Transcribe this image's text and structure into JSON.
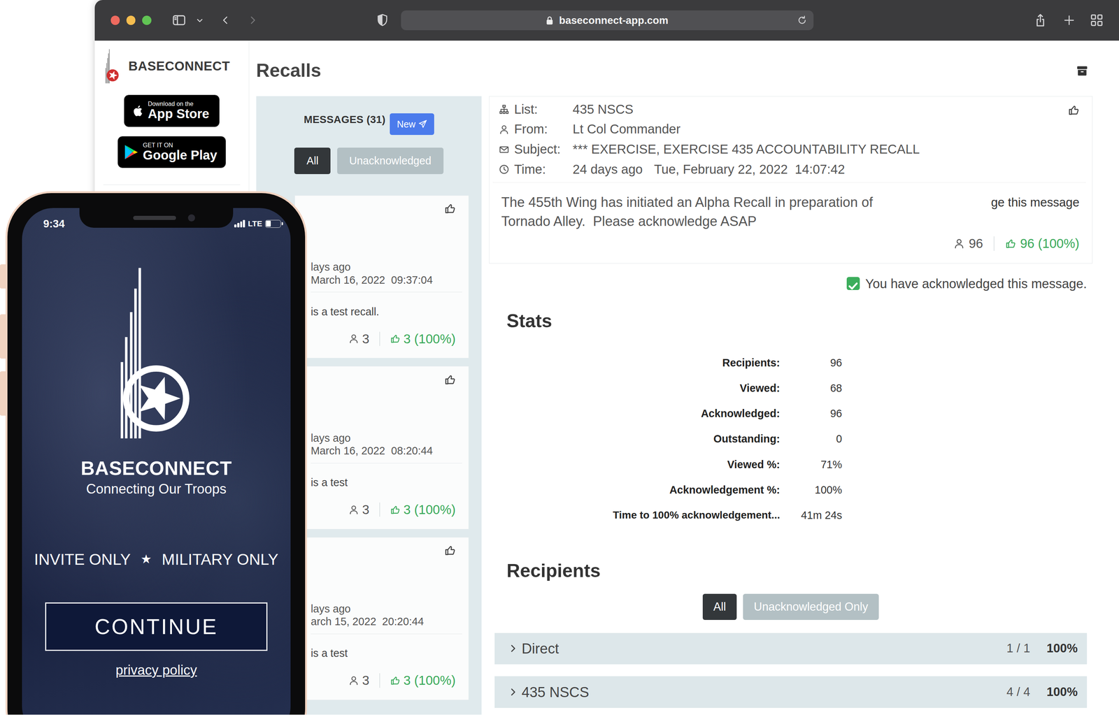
{
  "browser": {
    "traffic_lights": [
      {
        "color": "#ee6a5f"
      },
      {
        "color": "#f5bd4f"
      },
      {
        "color": "#61c454"
      }
    ],
    "url": "baseconnect-app.com"
  },
  "sidebar": {
    "brand": "BASECONNECT",
    "badges": [
      {
        "caption": "Download on the",
        "store": "App Store"
      },
      {
        "caption": "GET IT ON",
        "store": "Google Play"
      }
    ]
  },
  "page": {
    "title": "Recalls"
  },
  "messages": {
    "header": "MESSAGES (31)",
    "new_button": "New",
    "filters": [
      {
        "label": "All",
        "selected": true
      },
      {
        "label": "Unacknowledged",
        "selected": false
      }
    ],
    "items": [
      {
        "ago": "lays ago",
        "time": "March 16, 2022  09:37:04",
        "body": "is a test recall.",
        "recipients": "3",
        "acknowledged": "3 (100%)"
      },
      {
        "ago": "lays ago",
        "time": "March 16, 2022  08:20:44",
        "body": "is a test",
        "recipients": "3",
        "acknowledged": "3 (100%)"
      },
      {
        "ago": "lays ago",
        "time": "arch 15, 2022  20:20:44",
        "body": "is a test",
        "recipients": "3",
        "acknowledged": "3 (100%)"
      }
    ]
  },
  "detail": {
    "fields": [
      {
        "label": "List:",
        "value": "435 NSCS"
      },
      {
        "label": "From:",
        "value": "Lt Col Commander"
      },
      {
        "label": "Subject:",
        "value": "*** EXERCISE, EXERCISE 435 ACCOUNTABILITY RECALL"
      },
      {
        "label": "Time:",
        "value": "24 days ago",
        "extra": "Tue, February 22, 2022  14:07:42"
      }
    ],
    "body": "The 455th Wing has initiated an Alpha Recall in preparation of Tornado Alley.  Please acknowledge ASAP",
    "ack_hint": "ge this message",
    "recipient_count": "96",
    "ack_count": "96 (100%)",
    "acknowledged": true,
    "ack_note": "You have acknowledged this message."
  },
  "stats": {
    "title": "Stats",
    "rows": [
      {
        "label": "Recipients:",
        "value": "96"
      },
      {
        "label": "Viewed:",
        "value": "68"
      },
      {
        "label": "Acknowledged:",
        "value": "96"
      },
      {
        "label": "Outstanding:",
        "value": "0"
      },
      {
        "label": "Viewed %:",
        "value": "71%"
      },
      {
        "label": "Acknowledgement %:",
        "value": "100%"
      },
      {
        "label": "Time to 100% acknowledgement...",
        "value": "41m 24s"
      }
    ]
  },
  "recipients": {
    "title": "Recipients",
    "filters": [
      {
        "label": "All",
        "selected": true
      },
      {
        "label": "Unacknowledged Only",
        "selected": false
      }
    ],
    "groups": [
      {
        "name": "Direct",
        "count": "1 / 1",
        "percent": "100%",
        "expanded": false
      },
      {
        "name": "435 NSCS",
        "count": "4 / 4",
        "percent": "100%",
        "expanded": false
      }
    ]
  },
  "phone": {
    "time": "9:34",
    "network": "LTE",
    "battery": 0.35,
    "brand": "BASECONNECT",
    "tagline": "Connecting Our Troops",
    "invite": "INVITE ONLY",
    "star": "★",
    "military": "MILITARY ONLY",
    "continue": "CONTINUE",
    "privacy": "privacy policy"
  }
}
